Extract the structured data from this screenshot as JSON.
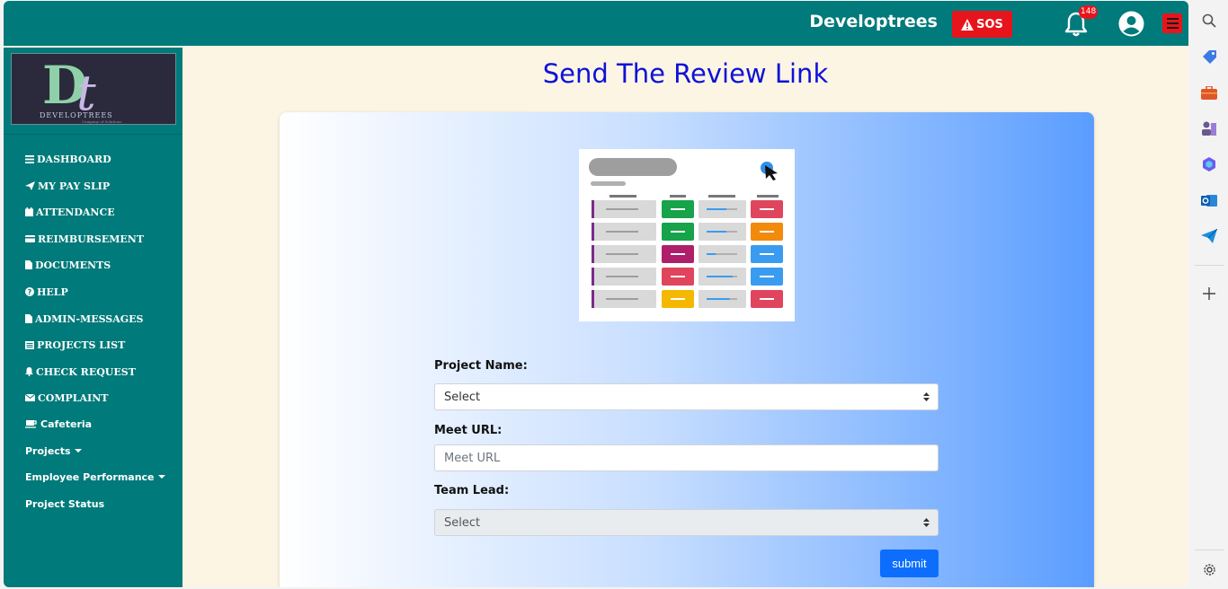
{
  "header": {
    "brand": "Developtrees",
    "sos_label": "SOS",
    "notification_count": "148"
  },
  "logo": {
    "monogram": "Dt",
    "name": "DEVELOPTREES",
    "tagline": "Company of Solutions"
  },
  "sidebar": {
    "items": [
      {
        "label": "DASHBOARD",
        "icon": "bars-icon"
      },
      {
        "label": "MY PAY SLIP",
        "icon": "paper-plane-icon"
      },
      {
        "label": "ATTENDANCE",
        "icon": "calendar-icon"
      },
      {
        "label": "REIMBURSEMENT",
        "icon": "credit-card-icon"
      },
      {
        "label": "DOCUMENTS",
        "icon": "file-icon"
      },
      {
        "label": "HELP",
        "icon": "question-circle-icon"
      },
      {
        "label": "ADMIN-MESSAGES",
        "icon": "file-icon"
      },
      {
        "label": "PROJECTS LIST",
        "icon": "list-icon"
      },
      {
        "label": "CHECK REQUEST",
        "icon": "bell-icon"
      },
      {
        "label": "COMPLAINT",
        "icon": "envelope-icon"
      },
      {
        "label": "Cafeteria",
        "icon": "coffee-icon"
      },
      {
        "label": "Projects",
        "icon": "caret-down-icon"
      },
      {
        "label": "Employee Performance",
        "icon": "caret-down-icon"
      },
      {
        "label": "Project Status",
        "icon": ""
      }
    ]
  },
  "main": {
    "title": "Send The Review Link",
    "form": {
      "project_name_label": "Project Name:",
      "project_name_value": "Select",
      "meet_url_label": "Meet URL:",
      "meet_url_placeholder": "Meet URL",
      "team_lead_label": "Team Lead:",
      "team_lead_value": "Select",
      "submit_label": "submit"
    }
  },
  "colors": {
    "teal": "#007a7a",
    "sos_red": "#e8141c",
    "title_blue": "#0d12d8",
    "button_blue": "#0d6efd",
    "page_bg": "#fdf5e4"
  },
  "rail": {
    "icons": [
      "search-icon",
      "tag-icon",
      "briefcase-icon",
      "chess-icon",
      "copilot-icon",
      "outlook-icon",
      "send-icon",
      "plus-icon",
      "settings-icon"
    ]
  }
}
